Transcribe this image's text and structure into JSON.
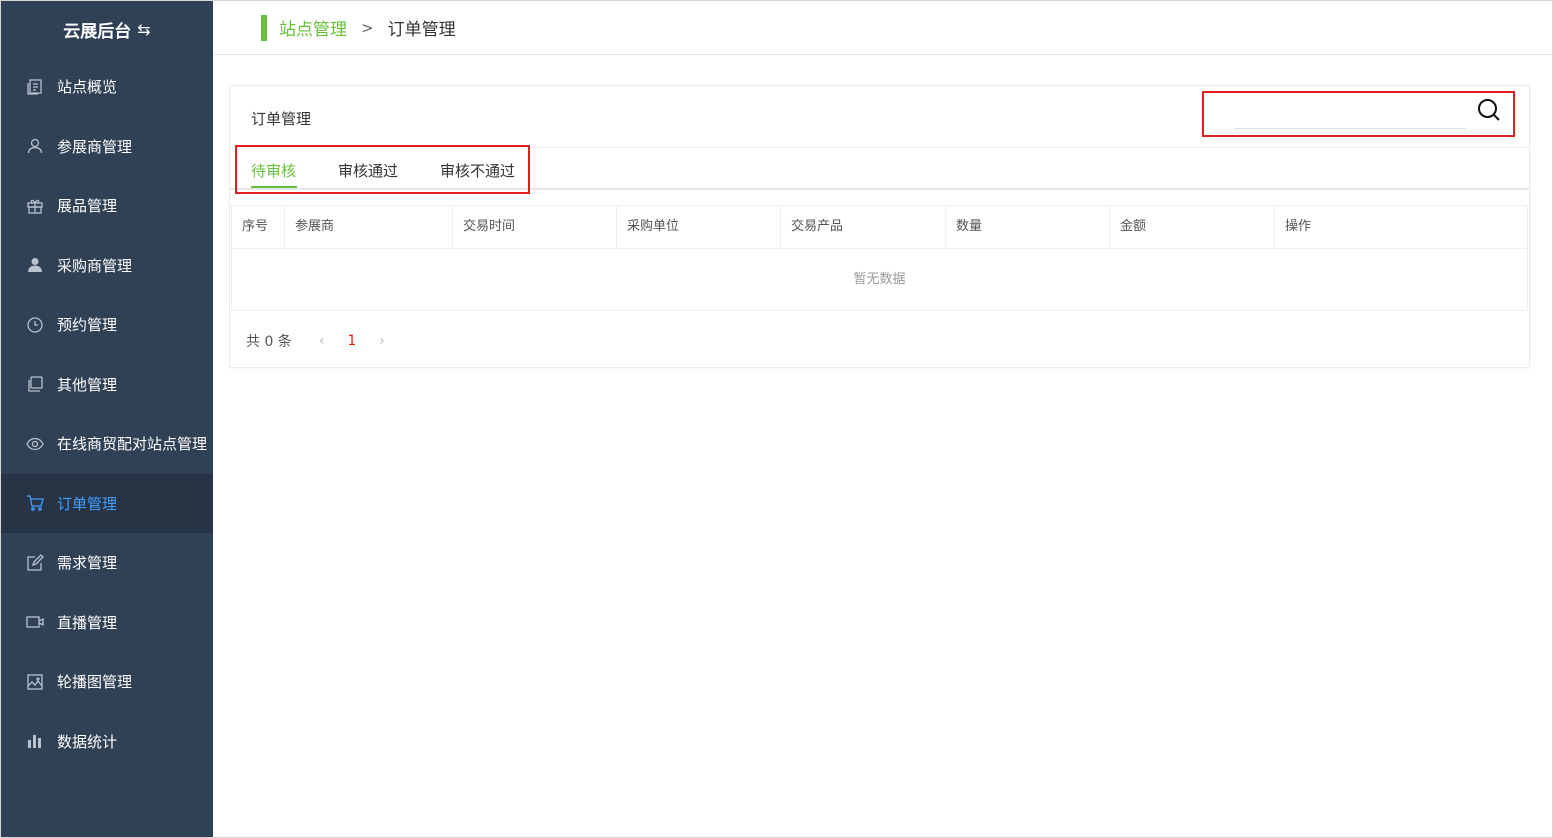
{
  "brand": {
    "title": "云展后台",
    "toggle_icon": "switch-icon"
  },
  "sidebar": {
    "items": [
      {
        "label": "站点概览",
        "icon": "document-icon"
      },
      {
        "label": "参展商管理",
        "icon": "user-icon"
      },
      {
        "label": "展品管理",
        "icon": "gift-icon"
      },
      {
        "label": "采购商管理",
        "icon": "person-icon"
      },
      {
        "label": "预约管理",
        "icon": "clock-icon"
      },
      {
        "label": "其他管理",
        "icon": "copy-icon"
      },
      {
        "label": "在线商贸配对站点管理",
        "icon": "eye-icon"
      },
      {
        "label": "订单管理",
        "icon": "cart-icon",
        "active": true
      },
      {
        "label": "需求管理",
        "icon": "edit-icon"
      },
      {
        "label": "直播管理",
        "icon": "video-icon"
      },
      {
        "label": "轮播图管理",
        "icon": "picture-icon"
      },
      {
        "label": "数据统计",
        "icon": "bar-chart-icon"
      }
    ]
  },
  "breadcrumb": {
    "parent": "站点管理",
    "separator": ">",
    "current": "订单管理"
  },
  "card": {
    "title": "订单管理"
  },
  "search": {
    "placeholder": "",
    "value": ""
  },
  "tabs": [
    {
      "label": "待审核",
      "active": true
    },
    {
      "label": "审核通过"
    },
    {
      "label": "审核不通过"
    }
  ],
  "table": {
    "columns": [
      "序号",
      "参展商",
      "交易时间",
      "采购单位",
      "交易产品",
      "数量",
      "金额",
      "操作"
    ],
    "empty_text": "暂无数据"
  },
  "pagination": {
    "total": "共 0 条",
    "current_page": "1",
    "prev": "‹",
    "next": "›"
  },
  "colors": {
    "sidebar_bg": "#304156",
    "active_menu": "#409eff",
    "accent_green": "#67c23a",
    "highlight_red": "#e02020"
  }
}
